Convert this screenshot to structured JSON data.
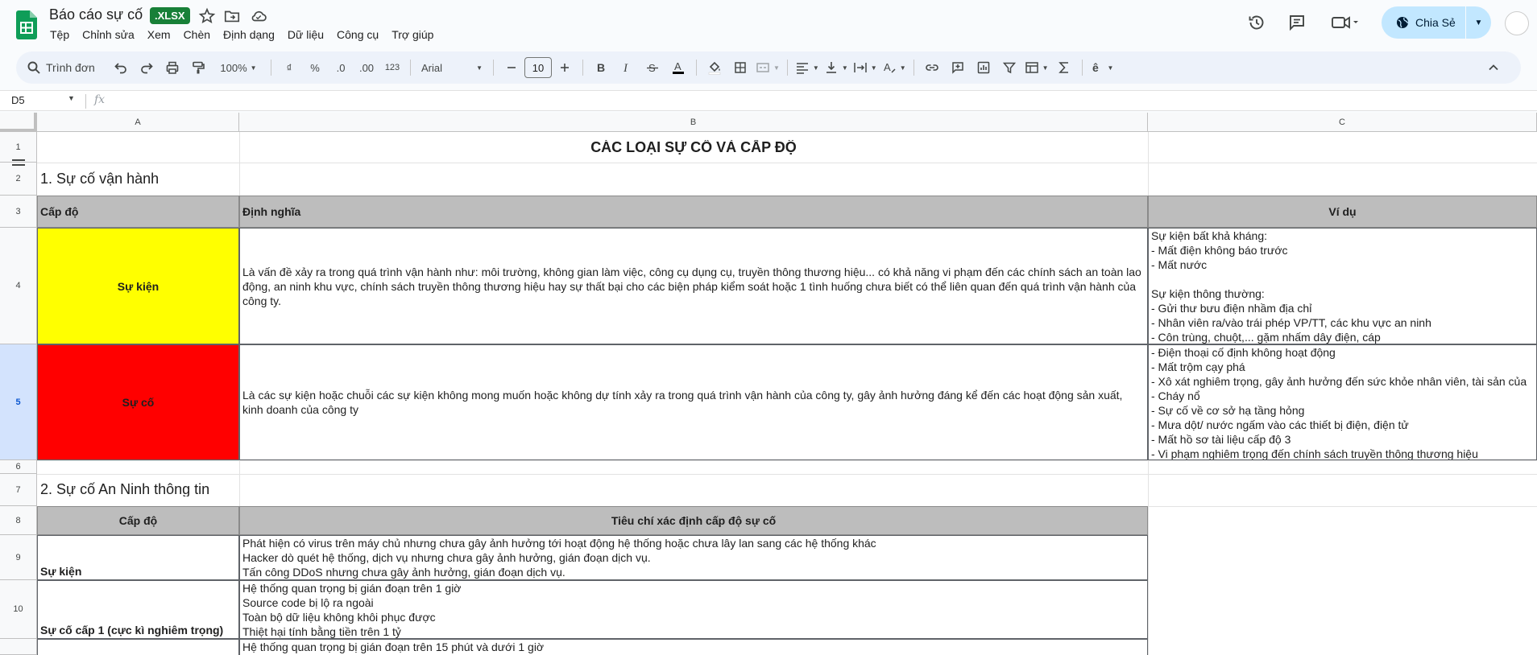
{
  "app": {
    "doc_title": "Báo cáo sự cố",
    "badge": ".XLSX",
    "share_label": "Chia Sẻ",
    "colors": {
      "xlsx_badge": "#188038",
      "share_bg": "#c2e7ff",
      "yellow": "#ffff00",
      "red": "#ff0000",
      "header_gray": "#bdbdbd"
    }
  },
  "menu": [
    "Tệp",
    "Chỉnh sửa",
    "Xem",
    "Chèn",
    "Định dạng",
    "Dữ liệu",
    "Công cụ",
    "Trợ giúp"
  ],
  "toolbar": {
    "search_label": "Trình đơn",
    "zoom": "100%",
    "currency": "₫",
    "percent": "%",
    "dec_decrease": ".0",
    "dec_increase": ".00",
    "format_123": "123",
    "font": "Arial",
    "font_size": "10"
  },
  "formula_bar": {
    "cell_ref": "D5",
    "fx": "fx",
    "content": ""
  },
  "columns": [
    "A",
    "B",
    "C"
  ],
  "rows": [
    "1",
    "2",
    "3",
    "4",
    "5",
    "6",
    "7",
    "8",
    "9",
    "10"
  ],
  "sheet": {
    "title": "CÁC LOẠI SỰ CỐ VÀ CẤP ĐỘ",
    "section1": "1. Sự cố vận hành",
    "table1": {
      "headers": [
        "Cấp độ",
        "Định nghĩa",
        "Ví dụ"
      ],
      "rows": [
        {
          "level": "Sự kiện",
          "definition": "Là vấn đề xảy ra trong quá trình vận hành như: môi trường, không gian làm việc, công cụ dụng cụ, truyền thông thương hiệu... có khả năng vi phạm đến các chính sách an toàn lao động, an ninh khu vực, chính sách truyền thông thương hiệu hay sự thất bại cho các biện pháp kiểm soát hoặc 1 tình huống chưa biết có thể liên quan đến quá trình vận hành của công ty.",
          "examples": "Sự kiện bất khả kháng:\n- Mất điện không báo trước\n- Mất nước\n\nSự kiện thông thường:\n- Gửi thư bưu điện nhầm địa chỉ\n- Nhân viên ra/vào trái phép VP/TT, các khu vực an ninh\n- Côn trùng, chuột,... gặm nhấm dây điện, cáp"
        },
        {
          "level": "Sự cố",
          "definition": "Là các sự kiện hoặc chuỗi các sự kiện không mong muốn hoặc không dự tính xảy ra trong quá trình vận hành của công ty, gây ảnh hưởng đáng kể đến các hoạt động sản xuất, kinh doanh của công ty",
          "examples": "- Điện thoại cố định không hoạt động\n- Mất trộm cạy phá\n- Xô xát nghiêm trọng, gây ảnh hưởng đến sức khỏe nhân viên, tài sản của\n- Cháy nổ\n- Sự cố về cơ sở hạ tầng hỏng\n- Mưa dột/ nước ngấm vào các thiết bị điện, điện tử\n- Mất hồ sơ tài liệu cấp độ 3\n- Vi phạm nghiêm trọng đến chính sách truyền thông thương hiệu"
        }
      ]
    },
    "section2": "2. Sự cố An Ninh thông tin",
    "table2": {
      "headers": [
        "Cấp độ",
        "Tiêu chí xác định cấp độ sự cố"
      ],
      "rows": [
        {
          "level": "Sự kiện",
          "criteria": "Phát hiện có virus trên máy chủ nhưng chưa gây ảnh hưởng tới hoạt động hệ thống hoặc chưa lây lan sang các hệ thống khác\nHacker dò quét hệ thống, dịch vụ nhưng chưa gây ảnh hưởng, gián đoạn dịch vụ.\nTấn công DDoS nhưng chưa gây ảnh hưởng, gián đoạn dịch vụ."
        },
        {
          "level": "Sự cố cấp 1 (cực kì nghiêm trọng)",
          "criteria": "Hệ thống quan trọng bị gián đoạn trên 1 giờ\nSource code bị lộ ra ngoài\nToàn bộ dữ liệu không khôi phục được\nThiệt hại tính bằng tiền trên 1 tỷ"
        },
        {
          "level": "",
          "criteria": "Hệ thống quan trọng bị gián đoạn trên 15 phút và dưới 1 giờ"
        }
      ]
    }
  }
}
